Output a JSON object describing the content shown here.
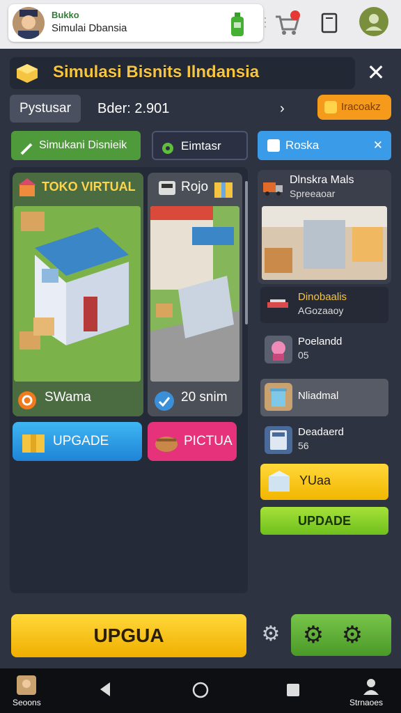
{
  "profile": {
    "name": "Bukko",
    "subtitle": "Simulai Dbansia"
  },
  "header": {
    "title": "Simulasi Bisnits Ilndansia",
    "close": "✕"
  },
  "tabs": {
    "left": "Pystusar",
    "order": "Bder: 2.901",
    "chevron": "›",
    "orange": "Iracoakz"
  },
  "chips": {
    "green": "Simukani Disnieik",
    "dark": "Eimtasr",
    "blue": "Roska",
    "blue_close": "✕"
  },
  "cards": [
    {
      "title": "TOKO VIRTUAL",
      "footer": "SWama"
    },
    {
      "title": "Rojo",
      "footer": "20 snim"
    }
  ],
  "buttons": {
    "upgrade_blue": "UPGADE",
    "pink": "PICTUA",
    "yellow_row": "YUaa",
    "lime": "UPDADE",
    "big_yellow": "UPGUA"
  },
  "right_card": {
    "title": "Dlnskra Mals",
    "subtitle": "Spreeaoar"
  },
  "right_rows": [
    {
      "line1": "Dinobaalis",
      "line2": "AGozaaoy"
    },
    {
      "line1": "Poelandd",
      "line2": "05"
    },
    {
      "line1": "Nliadmal",
      "line2": ""
    },
    {
      "line1": "Deadaerd",
      "line2": "56"
    }
  ],
  "navbar": {
    "left_label": "Seoons",
    "right_label": "Strnaoes"
  },
  "colors": {
    "accent_yellow": "#f5c542",
    "panel": "#2d3340",
    "green": "#4f9a3a",
    "blue": "#3a9be8",
    "orange": "#f59a1b",
    "pink": "#e6327a"
  },
  "icons": [
    "avatar",
    "bottle-icon",
    "cart-icon",
    "phone-icon",
    "user-icon",
    "cube-icon",
    "gear-icon",
    "back-icon",
    "home-icon",
    "recents-icon"
  ]
}
